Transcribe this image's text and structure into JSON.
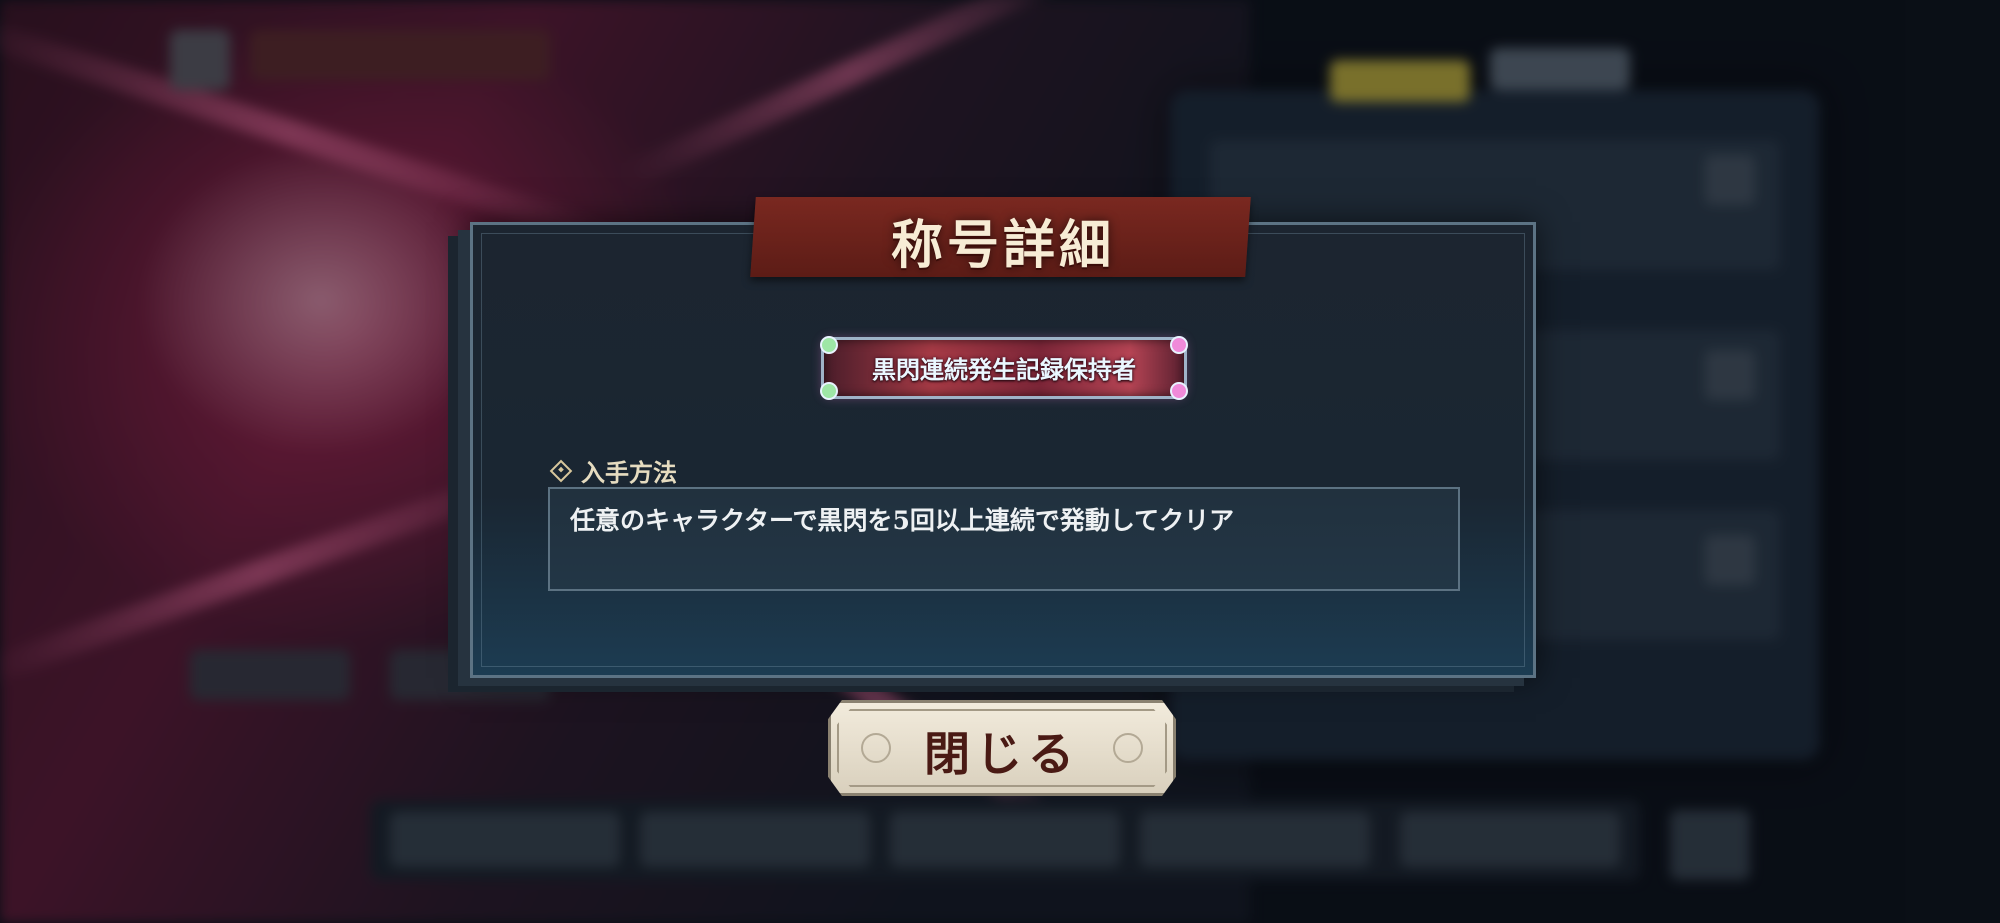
{
  "dialog": {
    "title": "称号詳細",
    "badge_title": "黒閃連続発生記録保持者",
    "method_label": "入手方法",
    "method_text": "任意のキャラクターで黒閃を5回以上連続で発動してクリア"
  },
  "buttons": {
    "close_label": "閉じる"
  },
  "colors": {
    "header_red": "#7a2820",
    "dialog_bg": "#1c2530",
    "title_text": "#f7ecd5",
    "close_button_bg": "#f2ebdc",
    "close_button_text": "#4a1a14"
  },
  "icons": {
    "method_marker": "diamond-icon",
    "badge_gems": "gem-icon"
  }
}
